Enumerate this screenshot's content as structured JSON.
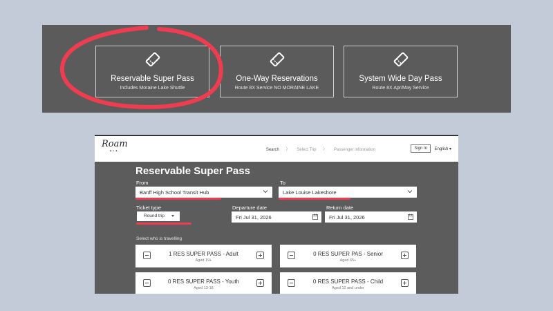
{
  "top_panel": {
    "cards": [
      {
        "title": "Reservable Super Pass",
        "subtitle": "Includes Moraine Lake Shuttle",
        "icon": "ticket-icon"
      },
      {
        "title": "One-Way Reservations",
        "subtitle": "Route 8X Service NO MORAINE LAKE",
        "icon": "ticket-icon"
      },
      {
        "title": "System Wide Day Pass",
        "subtitle": "Route 8X Apr/May Service",
        "icon": "ticket-icon"
      }
    ],
    "annotation_color": "#ee3c50"
  },
  "booking": {
    "logo": "Roam",
    "nav": {
      "steps": [
        "Search",
        "Select Trip",
        "Passenger information"
      ],
      "sign_in": "Sign In",
      "language": "English ▾"
    },
    "title": "Reservable Super Pass",
    "from": {
      "label": "From",
      "value": "Banff High School Transit Hub"
    },
    "to": {
      "label": "To",
      "value": "Lake Louise Lakeshore"
    },
    "ticket_type": {
      "label": "Ticket type",
      "value": "Round trip"
    },
    "departure": {
      "label": "Departure date",
      "value": "Fri Jul 31, 2026"
    },
    "return": {
      "label": "Return date",
      "value": "Fri Jul 31, 2026"
    },
    "who_label": "Select who is travelling",
    "passengers": [
      {
        "name": "1 RES SUPER PASS - Adult",
        "age": "Aged 19+"
      },
      {
        "name": "0 RES SUPER PAS - Senior",
        "age": "Aged 65+"
      },
      {
        "name": "0 RES SUPER PASS - Youth",
        "age": "Aged 13-18"
      },
      {
        "name": "0 RES SUPER PASS - Child",
        "age": "Aged 12 and under"
      }
    ]
  }
}
